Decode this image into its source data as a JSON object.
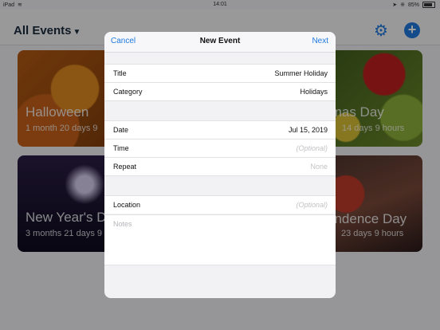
{
  "status": {
    "device": "iPad",
    "time": "14:01",
    "battery": "85%"
  },
  "header": {
    "title": "All Events"
  },
  "cards": [
    {
      "name": "Halloween",
      "time": "1 month  20 days  9"
    },
    {
      "name": "tmas Day",
      "time": "14 days  9 hours"
    },
    {
      "name": "New Year's D",
      "time": "3 months  21 days  9"
    },
    {
      "name": "endence Day",
      "time": "23 days  9 hours"
    }
  ],
  "modal": {
    "cancel": "Cancel",
    "title": "New Event",
    "next": "Next",
    "rows": {
      "title": {
        "label": "Title",
        "value": "Summer Holiday"
      },
      "category": {
        "label": "Category",
        "value": "Holidays"
      },
      "date": {
        "label": "Date",
        "value": "Jul 15, 2019"
      },
      "time": {
        "label": "Time",
        "value": "(Optional)"
      },
      "repeat": {
        "label": "Repeat",
        "value": "None"
      },
      "location": {
        "label": "Location",
        "value": "(Optional)"
      }
    },
    "notes_placeholder": "Notes"
  },
  "colors": {
    "accent": "#1f7ae0"
  }
}
